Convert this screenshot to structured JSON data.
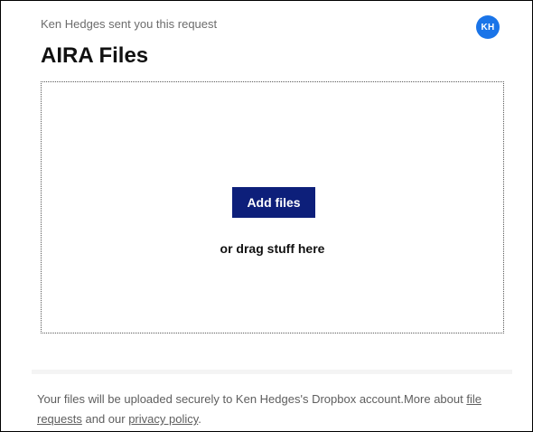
{
  "request": {
    "sender_line": "Ken Hedges sent you this request",
    "title": "AIRA Files",
    "avatar_initials": "KH"
  },
  "dropzone": {
    "button_label": "Add files",
    "drag_text": "or drag stuff here"
  },
  "footer": {
    "text_before": "Your files will be uploaded securely to Ken Hedges's Dropbox account.More about ",
    "link_file_requests": "file requests",
    "text_middle": " and our ",
    "link_privacy": "privacy policy",
    "text_end": "."
  },
  "colors": {
    "button_bg": "#0d1f7a",
    "avatar_bg": "#1a74e8"
  }
}
